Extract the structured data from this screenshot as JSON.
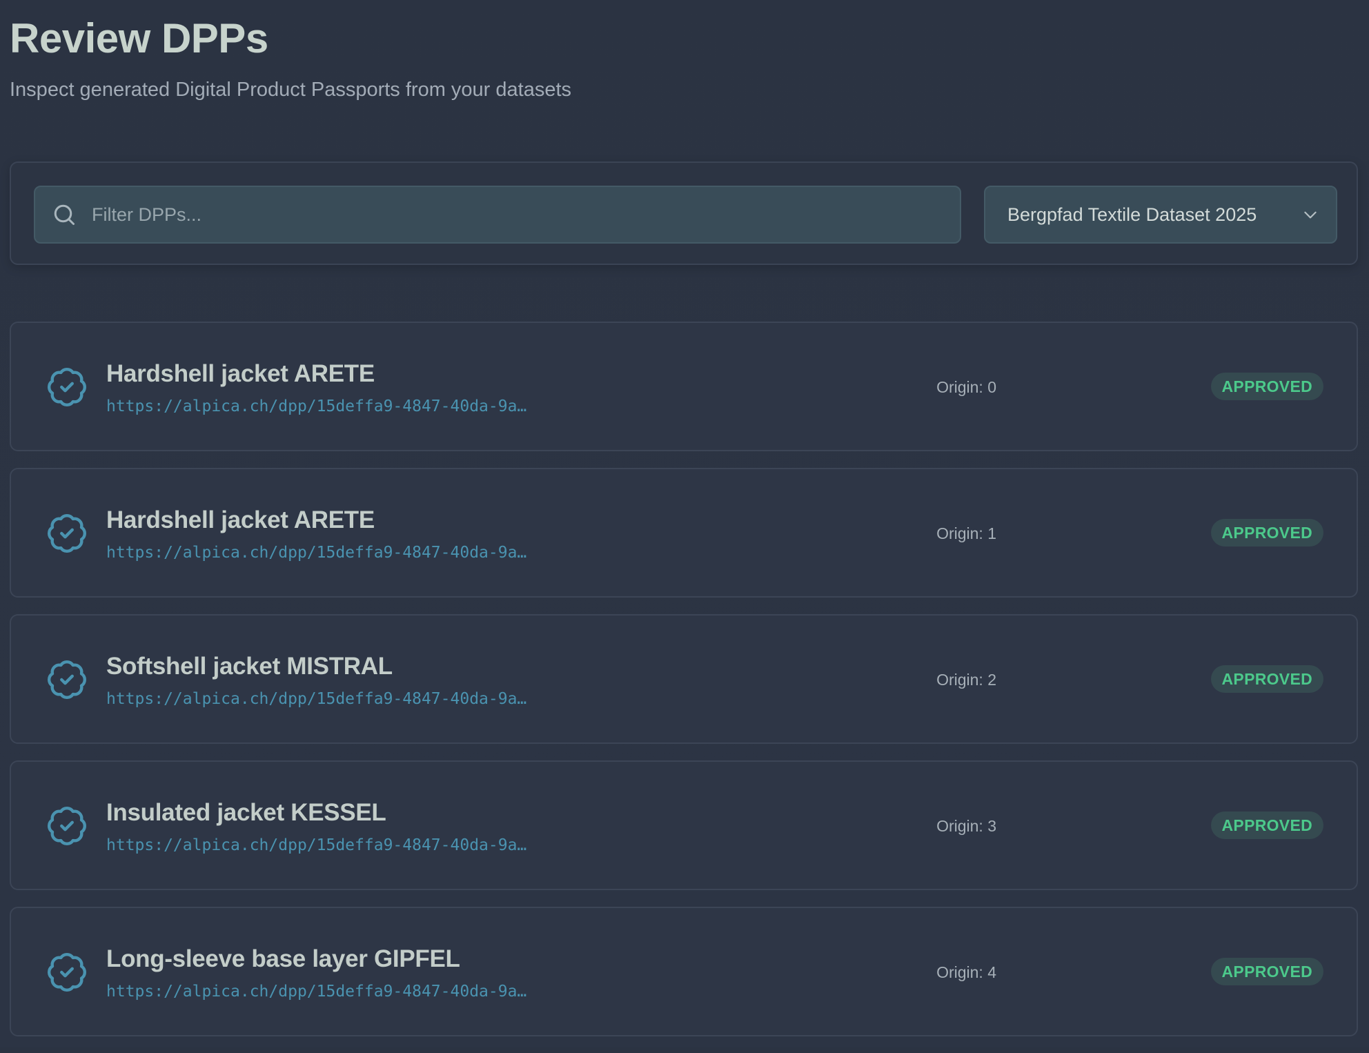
{
  "header": {
    "title": "Review DPPs",
    "subtitle": "Inspect generated Digital Product Passports from your datasets"
  },
  "filter": {
    "search_placeholder": "Filter DPPs...",
    "search_value": "",
    "dataset_selected": "Bergpfad Textile Dataset 2025"
  },
  "icons": {
    "search": "search-icon",
    "dropdown": "chevron-down-icon",
    "item_status": "badge-check-icon"
  },
  "colors": {
    "accent": "#4a93b0",
    "approved": "#4cc98b",
    "background": "#2b3342"
  },
  "dpps": [
    {
      "title": "Hardshell jacket ARETE",
      "url": "https://alpica.ch/dpp/15deffa9-4847-40da-9a…",
      "origin": "Origin: 0",
      "status": "APPROVED"
    },
    {
      "title": "Hardshell jacket ARETE",
      "url": "https://alpica.ch/dpp/15deffa9-4847-40da-9a…",
      "origin": "Origin: 1",
      "status": "APPROVED"
    },
    {
      "title": "Softshell jacket MISTRAL",
      "url": "https://alpica.ch/dpp/15deffa9-4847-40da-9a…",
      "origin": "Origin: 2",
      "status": "APPROVED"
    },
    {
      "title": "Insulated jacket KESSEL",
      "url": "https://alpica.ch/dpp/15deffa9-4847-40da-9a…",
      "origin": "Origin: 3",
      "status": "APPROVED"
    },
    {
      "title": "Long-sleeve base layer GIPFEL",
      "url": "https://alpica.ch/dpp/15deffa9-4847-40da-9a…",
      "origin": "Origin: 4",
      "status": "APPROVED"
    }
  ]
}
